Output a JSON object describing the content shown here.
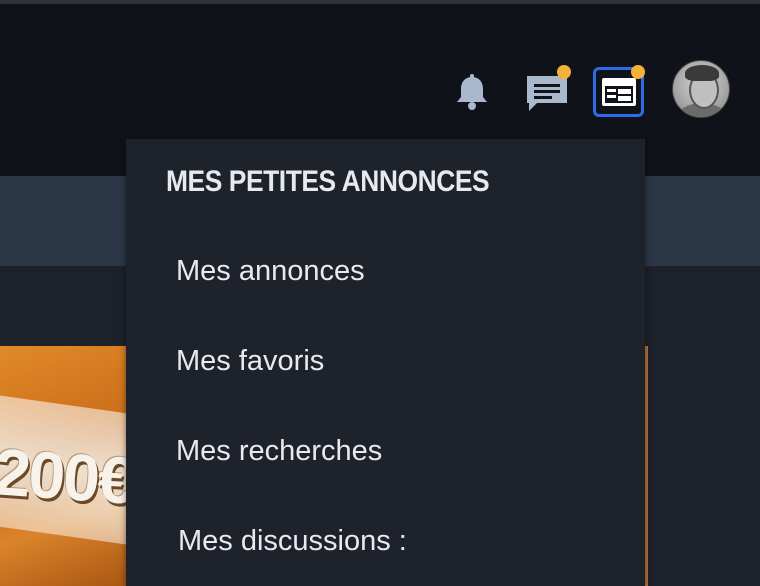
{
  "header": {
    "icons": [
      "bell-icon",
      "chat-icon",
      "annonces-icon",
      "avatar"
    ],
    "badge_color": "#f2b23a",
    "active_outline_color": "#2e6be6"
  },
  "ad": {
    "price_text": "200€"
  },
  "dropdown": {
    "title": "MES PETITES ANNONCES",
    "items": [
      {
        "label": "Mes annonces"
      },
      {
        "label": "Mes favoris"
      },
      {
        "label": "Mes recherches"
      },
      {
        "label": "Mes discussions :"
      }
    ]
  }
}
